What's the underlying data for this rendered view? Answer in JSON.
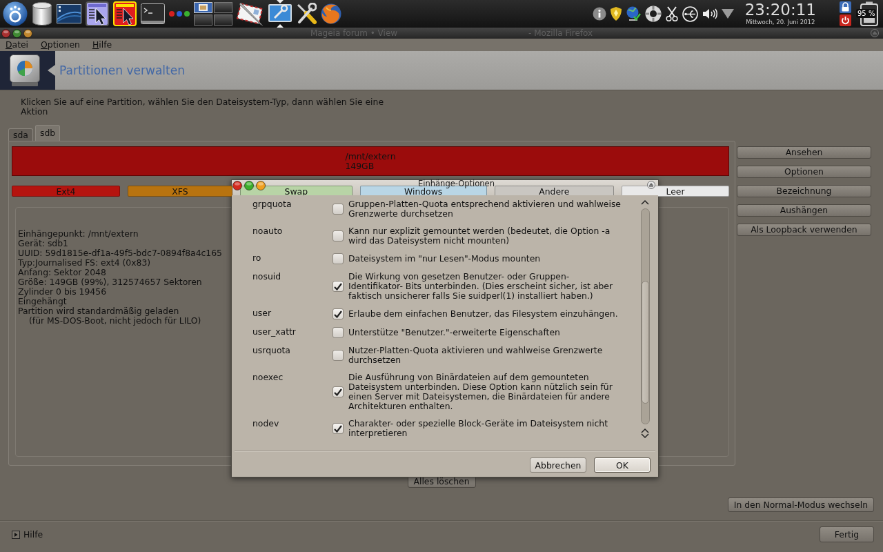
{
  "top_panel": {
    "clock": "23:20:11",
    "date": "Mittwoch, 20. Juni 2012",
    "battery": "95 %"
  },
  "window": {
    "title_start": "Mageia forum • View",
    "title_end": "- Mozilla Firefox"
  },
  "menu": [
    "Datei",
    "Optionen",
    "Hilfe"
  ],
  "header": {
    "title": "Partitionen verwalten"
  },
  "instruction": "Klicken Sie auf eine Partition, wählen Sie den Dateisystem-Typ, dann wählen Sie eine Aktion",
  "tabs": [
    {
      "label": "sda",
      "selected": false
    },
    {
      "label": "sdb",
      "selected": true
    }
  ],
  "partitions": [
    {
      "mount": "/mnt/extern",
      "size": "149GB",
      "color": "#9b0c0c"
    }
  ],
  "legend": [
    {
      "label": "Ext4",
      "color": "#b5140f"
    },
    {
      "label": "XFS",
      "color": "#b8730f"
    },
    {
      "label": "Swap",
      "color": "#b8d4a6"
    },
    {
      "label": "Windows",
      "color": "#b9d6e6"
    },
    {
      "label": "Andere",
      "color": "#c9c6c1"
    },
    {
      "label": "Leer",
      "color": "#e9e9e9"
    }
  ],
  "info": [
    {
      "text": "Einhängepunkt: /mnt/extern",
      "kind": "line"
    },
    {
      "text": "Gerät: sdb1",
      "kind": "line"
    },
    {
      "text": "UUID: 59d1815e-df1a-49f5-bdc7-0894f8a4c165",
      "kind": "line"
    },
    {
      "text": "Typ:Journalised FS: ext4 (0x83)",
      "kind": "line"
    },
    {
      "text": "Anfang: Sektor 2048",
      "kind": "line"
    },
    {
      "text": "Größe: 149GB (99%), 312574657 Sektoren",
      "kind": "line"
    },
    {
      "text": "Zylinder 0 bis 19456",
      "kind": "line"
    },
    {
      "text": "Eingehängt",
      "kind": "line"
    },
    {
      "text": "Partition wird standardmäßig geladen",
      "kind": "line"
    },
    {
      "text": "(für MS-DOS-Boot, nicht jedoch für LILO)",
      "kind": "indented"
    }
  ],
  "actions": [
    "Ansehen",
    "Optionen",
    "Bezeichnung",
    "Aushängen",
    "Als Loopback verwenden"
  ],
  "clear_button": "Alles löschen",
  "mode_button": "In den Normal-Modus wechseln",
  "help_expander": {
    "label": "Hilfe",
    "expanded": false
  },
  "done_button": "Fertig",
  "dialog": {
    "title": "Einhänge-Optionen",
    "options": [
      {
        "name": "grpquota",
        "description": "Gruppen-Platten-Quota entsprechend aktivieren und wahlweise Grenzwerte durchsetzen",
        "checked": false
      },
      {
        "name": "noauto",
        "description": "Kann nur explizit gemountet werden (bedeutet, die Option -a wird das Dateisystem nicht mounten)",
        "checked": false
      },
      {
        "name": "ro",
        "description": "Dateisystem im \"nur Lesen\"-Modus mounten",
        "checked": false
      },
      {
        "name": "nosuid",
        "description": "Die Wirkung von gesetzen Benutzer- oder Gruppen-Identifikator- Bits unterbinden. (Dies erscheint sicher, ist aber faktisch unsicherer falls Sie suidperl(1) installiert haben.)",
        "checked": true
      },
      {
        "name": "user",
        "description": "Erlaube dem einfachen Benutzer, das Filesystem einzuhängen.",
        "checked": true
      },
      {
        "name": "user_xattr",
        "description": "Unterstütze \"Benutzer.\"-erweiterte Eigenschaften",
        "checked": false
      },
      {
        "name": "usrquota",
        "description": "Nutzer-Platten-Quota aktivieren und wahlweise Grenzwerte durchsetzen",
        "checked": false
      },
      {
        "name": "noexec",
        "description": "Die Ausführung von Binärdateien auf dem gemounteten Dateisystem unterbinden. Diese Option kann nützlich sein für einen Server mit Dateisystemen, die Binärdateien für andere Architekturen enthalten.",
        "checked": true
      },
      {
        "name": "nodev",
        "description": "Charakter- oder spezielle Block-Geräte im Dateisystem nicht interpretieren",
        "checked": true
      }
    ],
    "buttons": [
      {
        "label": "Abbrechen",
        "default": false
      },
      {
        "label": "OK",
        "default": true
      }
    ]
  }
}
